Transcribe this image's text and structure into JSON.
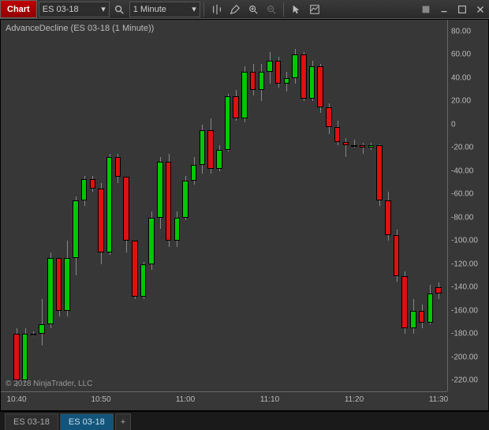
{
  "toolbar": {
    "chart_label": "Chart",
    "instrument": "ES 03-18",
    "interval": "1 Minute"
  },
  "chart": {
    "title": "AdvanceDecline (ES 03-18 (1 Minute))",
    "copyright": "© 2018 NinjaTrader, LLC",
    "y_ticks": [
      "80.00",
      "60.00",
      "40.00",
      "20.00",
      "0",
      "-20.00",
      "-40.00",
      "-60.00",
      "-80.00",
      "-100.00",
      "-120.00",
      "-140.00",
      "-160.00",
      "-180.00",
      "-200.00",
      "-220.00"
    ],
    "x_ticks": [
      "10:40",
      "10:50",
      "11:00",
      "11:10",
      "11:20",
      "11:30"
    ]
  },
  "tabs": {
    "items": [
      "ES 03-18",
      "ES 03-18"
    ],
    "plus": "+",
    "active_index": 1
  },
  "chart_data": {
    "type": "candlestick",
    "title": "AdvanceDecline (ES 03-18 (1 Minute))",
    "xlabel": "",
    "ylabel": "",
    "ylim": [
      -230,
      90
    ],
    "x_categories": [
      "10:40",
      "10:41",
      "10:42",
      "10:43",
      "10:44",
      "10:45",
      "10:46",
      "10:47",
      "10:48",
      "10:49",
      "10:50",
      "10:51",
      "10:52",
      "10:53",
      "10:54",
      "10:55",
      "10:56",
      "10:57",
      "10:58",
      "10:59",
      "11:00",
      "11:01",
      "11:02",
      "11:03",
      "11:04",
      "11:05",
      "11:06",
      "11:07",
      "11:08",
      "11:09",
      "11:10",
      "11:11",
      "11:12",
      "11:13",
      "11:14",
      "11:15",
      "11:16",
      "11:17",
      "11:18",
      "11:19",
      "11:20",
      "11:21",
      "11:22",
      "11:23",
      "11:24",
      "11:25",
      "11:26",
      "11:27",
      "11:28",
      "11:29",
      "11:30"
    ],
    "series": [
      {
        "name": "AdvanceDecline",
        "ohlc": [
          [
            -180,
            -175,
            -225,
            -220
          ],
          [
            -220,
            -175,
            -222,
            -180
          ],
          [
            -180,
            -178,
            -182,
            -180
          ],
          [
            -180,
            -150,
            -190,
            -172
          ],
          [
            -172,
            -110,
            -175,
            -115
          ],
          [
            -115,
            -120,
            -165,
            -160
          ],
          [
            -160,
            -100,
            -165,
            -115
          ],
          [
            -115,
            -62,
            -130,
            -65
          ],
          [
            -65,
            -44,
            -70,
            -47
          ],
          [
            -47,
            -44,
            -58,
            -55
          ],
          [
            -55,
            -50,
            -120,
            -110
          ],
          [
            -110,
            -25,
            -112,
            -28
          ],
          [
            -28,
            -25,
            -50,
            -45
          ],
          [
            -45,
            -78,
            -110,
            -100
          ],
          [
            -100,
            -100,
            -150,
            -148
          ],
          [
            -148,
            -118,
            -150,
            -120
          ],
          [
            -120,
            -75,
            -125,
            -80
          ],
          [
            -80,
            -28,
            -90,
            -32
          ],
          [
            -32,
            -25,
            -105,
            -100
          ],
          [
            -100,
            -75,
            -105,
            -80
          ],
          [
            -80,
            -44,
            -82,
            -48
          ],
          [
            -48,
            -28,
            -52,
            -35
          ],
          [
            -35,
            0,
            -42,
            -5
          ],
          [
            -5,
            5,
            -42,
            -38
          ],
          [
            -38,
            -18,
            -40,
            -22
          ],
          [
            -22,
            26,
            -23,
            24
          ],
          [
            24,
            30,
            3,
            5
          ],
          [
            5,
            50,
            2,
            45
          ],
          [
            45,
            52,
            25,
            30
          ],
          [
            30,
            52,
            20,
            45
          ],
          [
            45,
            62,
            35,
            55
          ],
          [
            55,
            58,
            32,
            35
          ],
          [
            35,
            45,
            28,
            40
          ],
          [
            40,
            65,
            35,
            60
          ],
          [
            60,
            62,
            20,
            22
          ],
          [
            22,
            55,
            20,
            50
          ],
          [
            50,
            52,
            10,
            15
          ],
          [
            15,
            18,
            -8,
            -2
          ],
          [
            -2,
            3,
            -18,
            -15
          ],
          [
            -15,
            -12,
            -28,
            -18
          ],
          [
            -18,
            -13,
            -20,
            -18
          ],
          [
            -18,
            -16,
            -25,
            -20
          ],
          [
            -20,
            -16,
            -22,
            -18
          ],
          [
            -18,
            -17,
            -70,
            -65
          ],
          [
            -65,
            -58,
            -100,
            -95
          ],
          [
            -95,
            -90,
            -135,
            -130
          ],
          [
            -130,
            -126,
            -180,
            -175
          ],
          [
            -175,
            -150,
            -180,
            -160
          ],
          [
            -160,
            -155,
            -175,
            -170
          ],
          [
            -170,
            -138,
            -172,
            -145
          ],
          [
            -140,
            -136,
            -150,
            -145
          ]
        ]
      }
    ]
  }
}
